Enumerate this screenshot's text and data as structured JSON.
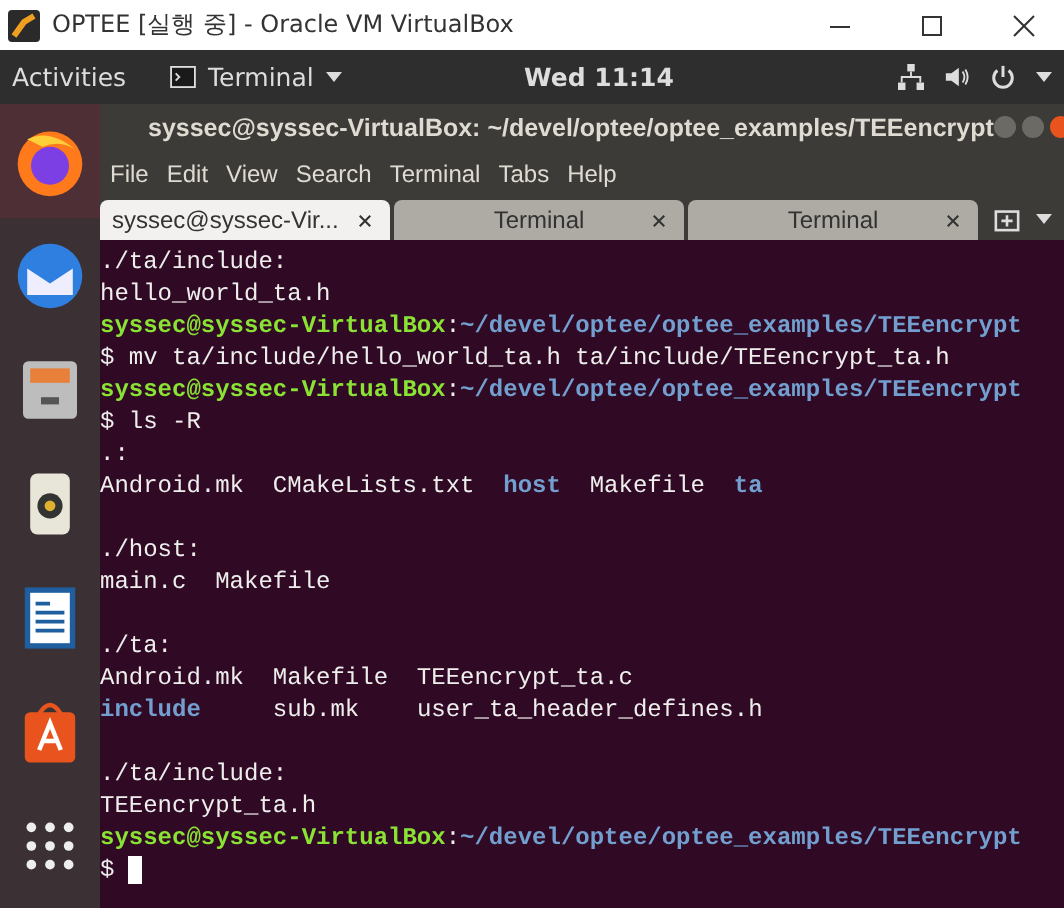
{
  "window": {
    "title": "OPTEE [실행 중] - Oracle VM VirtualBox"
  },
  "top_bar": {
    "activities": "Activities",
    "app_menu": "Terminal",
    "clock": "Wed 11:14"
  },
  "dock": {
    "items": [
      {
        "kind": "browser",
        "active": true
      },
      {
        "kind": "mail",
        "active": false
      },
      {
        "kind": "files",
        "active": false
      },
      {
        "kind": "speaker",
        "active": false
      },
      {
        "kind": "document",
        "active": false
      },
      {
        "kind": "store",
        "active": false
      },
      {
        "kind": "grid",
        "active": false
      }
    ]
  },
  "terminal": {
    "title": "syssec@syssec-VirtualBox: ~/devel/optee/optee_examples/TEEencrypt",
    "menu": [
      "File",
      "Edit",
      "View",
      "Search",
      "Terminal",
      "Tabs",
      "Help"
    ],
    "tabs": [
      {
        "label": "syssec@syssec-Vir...",
        "selected": true
      },
      {
        "label": "Terminal",
        "selected": false
      },
      {
        "label": "Terminal",
        "selected": false
      }
    ],
    "lines": [
      {
        "kind": "output",
        "segments": [
          {
            "kind": "plain",
            "text": "./ta/include:"
          }
        ]
      },
      {
        "kind": "output",
        "segments": [
          {
            "kind": "plain",
            "text": "hello_world_ta.h"
          }
        ]
      },
      {
        "kind": "prompt",
        "segments": [
          {
            "kind": "user",
            "text": "syssec@syssec-VirtualBox"
          },
          {
            "kind": "plain",
            "text": ":"
          },
          {
            "kind": "path",
            "text": "~/devel/optee/optee_examples/TEEencrypt"
          }
        ]
      },
      {
        "kind": "command",
        "segments": [
          {
            "kind": "plain",
            "text": "$ mv ta/include/hello_world_ta.h ta/include/TEEencrypt_ta.h"
          }
        ]
      },
      {
        "kind": "prompt",
        "segments": [
          {
            "kind": "user",
            "text": "syssec@syssec-VirtualBox"
          },
          {
            "kind": "plain",
            "text": ":"
          },
          {
            "kind": "path",
            "text": "~/devel/optee/optee_examples/TEEencrypt"
          }
        ]
      },
      {
        "kind": "command",
        "segments": [
          {
            "kind": "plain",
            "text": "$ ls -R"
          }
        ]
      },
      {
        "kind": "output",
        "segments": [
          {
            "kind": "plain",
            "text": ".:"
          }
        ]
      },
      {
        "kind": "output",
        "segments": [
          {
            "kind": "plain",
            "text": "Android.mk  CMakeLists.txt  "
          },
          {
            "kind": "dir",
            "text": "host"
          },
          {
            "kind": "plain",
            "text": "  Makefile  "
          },
          {
            "kind": "dir",
            "text": "ta"
          }
        ]
      },
      {
        "kind": "blank"
      },
      {
        "kind": "output",
        "segments": [
          {
            "kind": "plain",
            "text": "./host:"
          }
        ]
      },
      {
        "kind": "output",
        "segments": [
          {
            "kind": "plain",
            "text": "main.c  Makefile"
          }
        ]
      },
      {
        "kind": "blank"
      },
      {
        "kind": "output",
        "segments": [
          {
            "kind": "plain",
            "text": "./ta:"
          }
        ]
      },
      {
        "kind": "output",
        "segments": [
          {
            "kind": "plain",
            "text": "Android.mk  Makefile  TEEencrypt_ta.c"
          }
        ]
      },
      {
        "kind": "output",
        "segments": [
          {
            "kind": "dir",
            "text": "include"
          },
          {
            "kind": "plain",
            "text": "     sub.mk    user_ta_header_defines.h"
          }
        ]
      },
      {
        "kind": "blank"
      },
      {
        "kind": "output",
        "segments": [
          {
            "kind": "plain",
            "text": "./ta/include:"
          }
        ]
      },
      {
        "kind": "output",
        "segments": [
          {
            "kind": "plain",
            "text": "TEEencrypt_ta.h"
          }
        ]
      },
      {
        "kind": "prompt",
        "segments": [
          {
            "kind": "user",
            "text": "syssec@syssec-VirtualBox"
          },
          {
            "kind": "plain",
            "text": ":"
          },
          {
            "kind": "path",
            "text": "~/devel/optee/optee_examples/TEEencrypt"
          }
        ]
      },
      {
        "kind": "input",
        "segments": [
          {
            "kind": "plain",
            "text": "$"
          }
        ]
      }
    ]
  }
}
